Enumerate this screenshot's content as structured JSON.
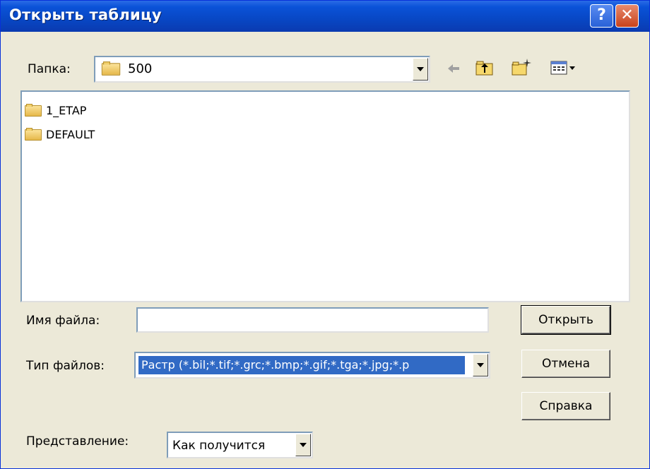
{
  "window": {
    "title": "Открыть таблицу"
  },
  "titlebar": {
    "help_label": "?",
    "close_label": "✕"
  },
  "folder_bar": {
    "label": "Папка:",
    "current_folder": "500"
  },
  "toolbar": {
    "back_icon": "back-arrow-icon",
    "up_icon": "up-folder-icon",
    "new_folder_icon": "new-folder-icon",
    "view_menu_icon": "view-menu-icon"
  },
  "files": [
    {
      "name": "1_ETAP",
      "type": "folder"
    },
    {
      "name": "DEFAULT",
      "type": "folder"
    }
  ],
  "filename": {
    "label": "Имя файла:",
    "value": ""
  },
  "filetype": {
    "label": "Тип файлов:",
    "value": "Растр (*.bil;*.tif;*.grc;*.bmp;*.gif;*.tga;*.jpg;*.p"
  },
  "view_mode": {
    "label": "Представление:",
    "value": "Как получится"
  },
  "buttons": {
    "open": "Открыть",
    "cancel": "Отмена",
    "help": "Справка"
  },
  "colors": {
    "titlebar": "#0a52d8",
    "selection": "#316ac5",
    "dialog_bg": "#ece9d8"
  }
}
